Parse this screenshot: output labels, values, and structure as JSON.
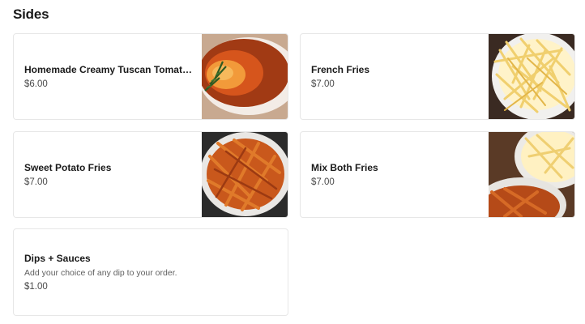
{
  "section": {
    "title": "Sides"
  },
  "items": [
    {
      "name": "Homemade Creamy Tuscan Tomato S...",
      "price": "$6.00",
      "image": "tomato-soup"
    },
    {
      "name": "French Fries",
      "price": "$7.00",
      "image": "french-fries"
    },
    {
      "name": "Sweet Potato Fries",
      "price": "$7.00",
      "image": "sweet-potato-fries"
    },
    {
      "name": "Mix Both Fries",
      "price": "$7.00",
      "image": "mixed-fries"
    },
    {
      "name": "Dips + Sauces",
      "description": "Add your choice of any dip to your order.",
      "price": "$1.00"
    }
  ]
}
